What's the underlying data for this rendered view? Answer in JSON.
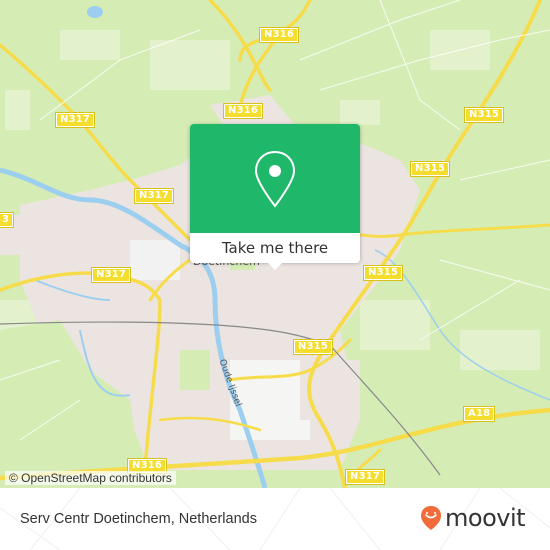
{
  "map": {
    "road_labels": [
      {
        "id": "n316-top",
        "text": "N316"
      },
      {
        "id": "n317-nw",
        "text": "N317"
      },
      {
        "id": "n316-mid",
        "text": "N316"
      },
      {
        "id": "n315-ne",
        "text": "N315"
      },
      {
        "id": "n317-center",
        "text": "N317"
      },
      {
        "id": "n315-east",
        "text": "N315"
      },
      {
        "id": "n13-west",
        "text": "3"
      },
      {
        "id": "n317-west",
        "text": "N317"
      },
      {
        "id": "n315-mid",
        "text": "N315"
      },
      {
        "id": "n315-south",
        "text": "N315"
      },
      {
        "id": "a18",
        "text": "A18"
      },
      {
        "id": "n316-south",
        "text": "N316"
      },
      {
        "id": "n317-south",
        "text": "N317"
      }
    ],
    "place_labels": {
      "city": "Doetinchem",
      "river": "Oude Ijssel"
    },
    "attribution": "© OpenStreetMap contributors",
    "colors": {
      "forest": "#d6ecb5",
      "urban": "#ece4e0",
      "road": "#f6dc4a",
      "water": "#9ccfef",
      "railway": "#888888"
    }
  },
  "popup": {
    "icon": "map-pin-icon",
    "action_label": "Take me there",
    "color": "#1fb86b"
  },
  "footer": {
    "location_title": "Serv Centr Doetinchem, Netherlands",
    "brand": "moovit",
    "brand_color": "#f26b3a"
  }
}
